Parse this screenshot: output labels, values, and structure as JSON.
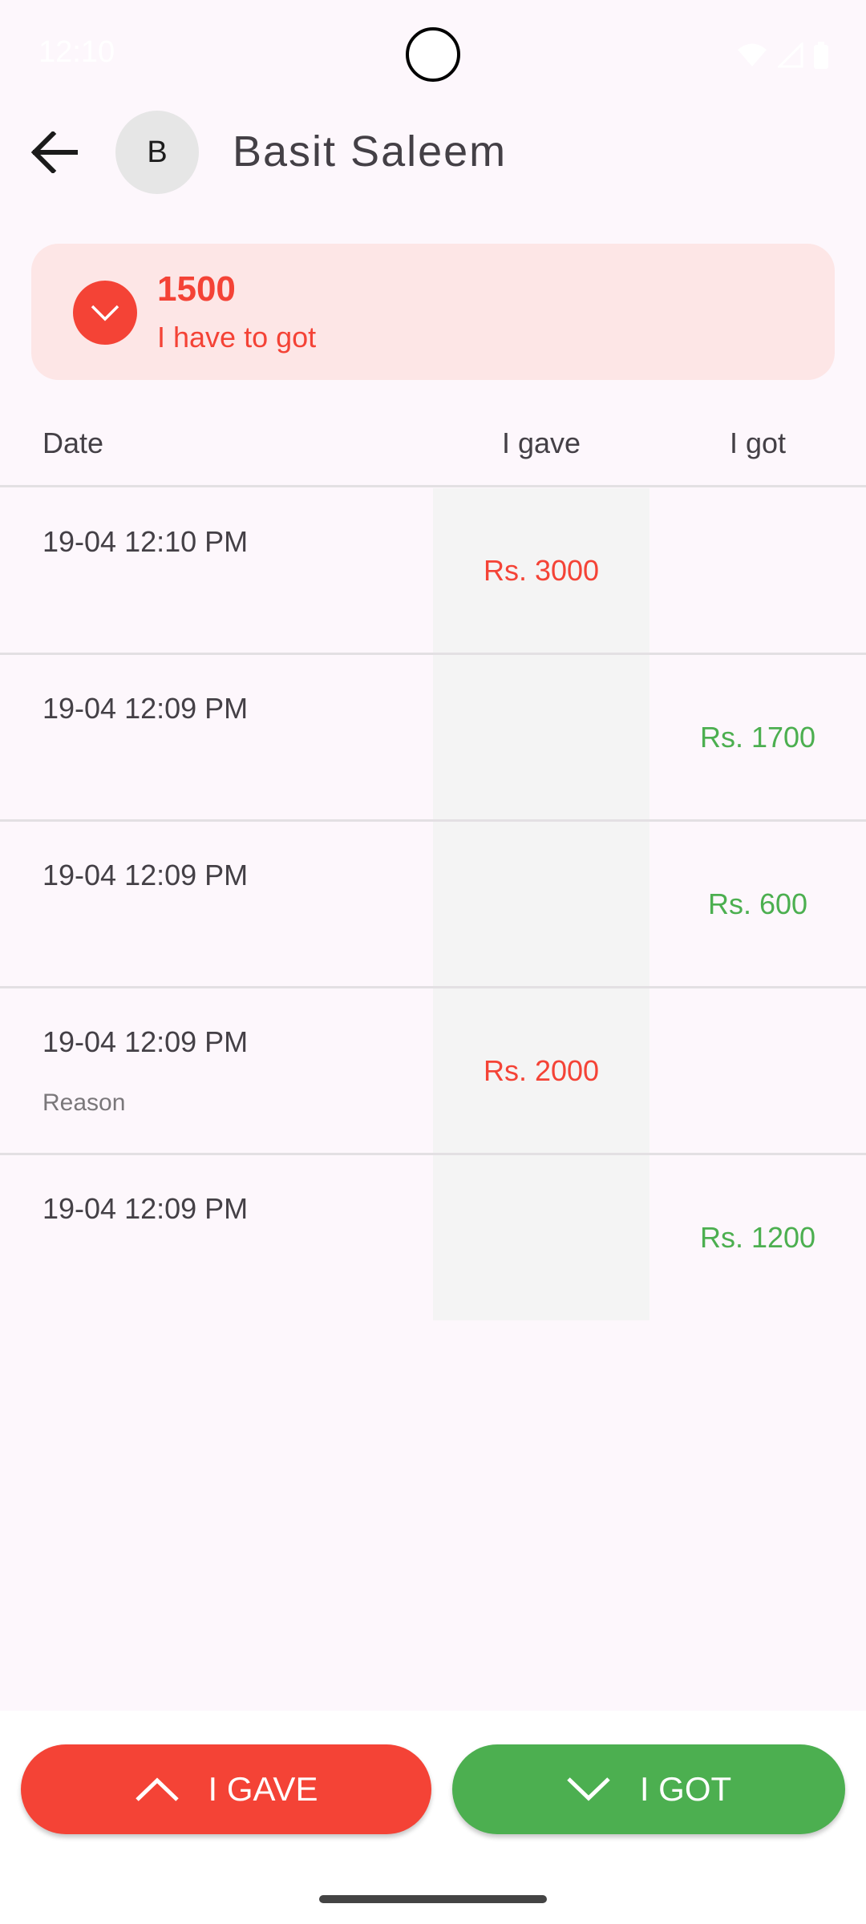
{
  "status_bar": {
    "time": "12:10",
    "icons": [
      "wifi-icon",
      "signal-icon",
      "battery-icon"
    ]
  },
  "header": {
    "back_icon": "arrow-back-icon",
    "avatar_initial": "B",
    "contact_name": "Basit Saleem"
  },
  "balance": {
    "amount": "1500",
    "label": "I have to got",
    "icon": "chevron-down-icon",
    "color": "#f44336",
    "background": "#fde6e6"
  },
  "table": {
    "headers": {
      "date": "Date",
      "gave": "I gave",
      "got": "I got"
    },
    "rows": [
      {
        "date": "19-04 12:10 PM",
        "gave": "Rs. 3000",
        "got": "",
        "reason": ""
      },
      {
        "date": "19-04 12:09 PM",
        "gave": "",
        "got": "Rs. 1700",
        "reason": ""
      },
      {
        "date": "19-04 12:09 PM",
        "gave": "",
        "got": "Rs. 600",
        "reason": ""
      },
      {
        "date": "19-04 12:09 PM",
        "gave": "Rs. 2000",
        "got": "",
        "reason": "Reason"
      },
      {
        "date": "19-04 12:09 PM",
        "gave": "",
        "got": "Rs. 1200",
        "reason": ""
      }
    ]
  },
  "actions": {
    "gave_label": "I GAVE",
    "got_label": "I GOT",
    "gave_icon": "chevron-up-icon",
    "got_icon": "chevron-down-icon",
    "gave_color": "#f44336",
    "got_color": "#4caf50"
  }
}
